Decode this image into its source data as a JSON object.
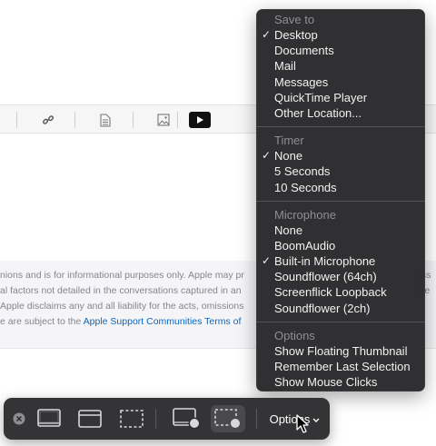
{
  "menu": {
    "sections": [
      {
        "header": "Save to",
        "items": [
          {
            "label": "Desktop",
            "checked": true
          },
          {
            "label": "Documents",
            "checked": false
          },
          {
            "label": "Mail",
            "checked": false
          },
          {
            "label": "Messages",
            "checked": false
          },
          {
            "label": "QuickTime Player",
            "checked": false
          },
          {
            "label": "Other Location...",
            "checked": false
          }
        ]
      },
      {
        "header": "Timer",
        "items": [
          {
            "label": "None",
            "checked": true
          },
          {
            "label": "5 Seconds",
            "checked": false
          },
          {
            "label": "10 Seconds",
            "checked": false
          }
        ]
      },
      {
        "header": "Microphone",
        "items": [
          {
            "label": "None",
            "checked": false
          },
          {
            "label": "BoomAudio",
            "checked": false
          },
          {
            "label": "Built-in Microphone",
            "checked": true
          },
          {
            "label": "Soundflower (64ch)",
            "checked": false
          },
          {
            "label": "Screenflick Loopback",
            "checked": false
          },
          {
            "label": "Soundflower (2ch)",
            "checked": false
          }
        ]
      },
      {
        "header": "Options",
        "items": [
          {
            "label": "Show Floating Thumbnail",
            "checked": false
          },
          {
            "label": "Remember Last Selection",
            "checked": false
          },
          {
            "label": "Show Mouse Clicks",
            "checked": false
          }
        ]
      }
    ]
  },
  "capture_bar": {
    "options_label": "Options",
    "buttons": [
      {
        "name": "close-icon"
      },
      {
        "name": "capture-entire-screen-icon"
      },
      {
        "name": "capture-window-icon"
      },
      {
        "name": "capture-selection-icon"
      },
      {
        "name": "record-entire-screen-icon"
      },
      {
        "name": "record-selection-icon",
        "selected": true
      }
    ]
  },
  "background": {
    "legal_lines": [
      "nions and is for informational purposes only. Apple may pr",
      "al factors not detailed in the conversations captured in an",
      "Apple disclaims any and all liability for the acts, omissions",
      "e are subject to the "
    ],
    "legal_line_tails": [
      "oss",
      "ore",
      "",
      ""
    ],
    "legal_link": "Apple Support Communities Terms of"
  }
}
